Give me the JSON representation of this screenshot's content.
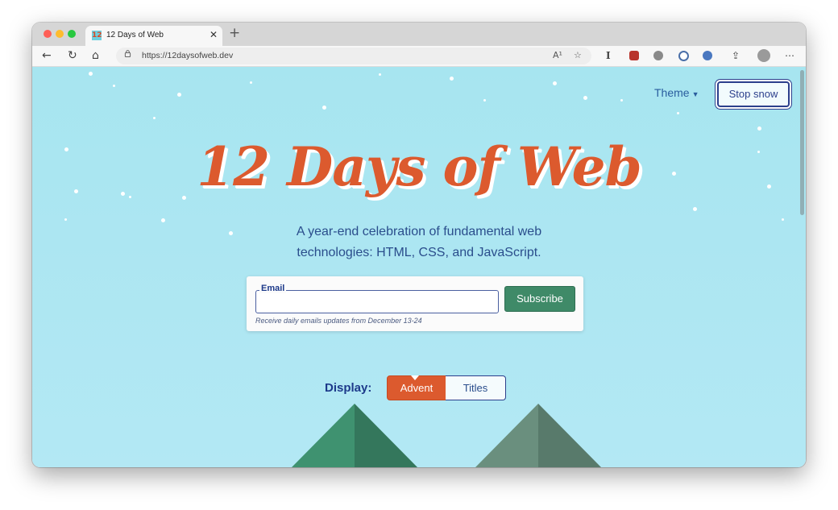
{
  "browser": {
    "tab_title": "12 Days of Web",
    "favicon_text": "12",
    "url": "https://12daysofweb.dev",
    "reader_icon_text": "A¹",
    "ext_text_icon": "I"
  },
  "page": {
    "theme_label": "Theme",
    "stop_snow_label": "Stop snow",
    "title": "12 Days of Web",
    "subtitle": "A year-end celebration of fundamental web technologies: HTML, CSS, and JavaScript.",
    "form": {
      "email_label": "Email",
      "email_value": "",
      "subscribe_label": "Subscribe",
      "hint": "Receive daily emails updates from December 13-24"
    },
    "display": {
      "label": "Display:",
      "options": [
        "Advent",
        "Titles"
      ],
      "selected": "Advent"
    }
  },
  "colors": {
    "sky": "#a7e5f0",
    "title": "#dc5a2e",
    "navy": "#1d3a8a",
    "green": "#3f8a68",
    "tree_left": "#3f8a6a",
    "tree_right": "#5e8573"
  }
}
